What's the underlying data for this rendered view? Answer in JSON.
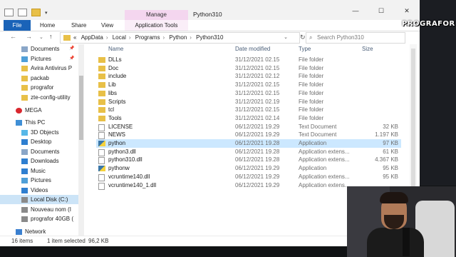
{
  "window": {
    "title": "Python310",
    "manage_tab": "Manage"
  },
  "ribbon": {
    "tabs": [
      "File",
      "Home",
      "Share",
      "View",
      "Application Tools"
    ]
  },
  "address": {
    "crumbs": [
      "AppData",
      "Local",
      "Programs",
      "Python",
      "Python310"
    ],
    "prefix": "«"
  },
  "search": {
    "placeholder": "Search Python310"
  },
  "columns": {
    "name": "Name",
    "date": "Date modified",
    "type": "Type",
    "size": "Size"
  },
  "navpane": [
    {
      "label": "Documents",
      "icon": "documents-icon",
      "pinned": true
    },
    {
      "label": "Pictures",
      "icon": "pictures-icon",
      "pinned": true
    },
    {
      "label": "Avira Antivirus P",
      "icon": "folder-icon",
      "pinned": false
    },
    {
      "label": "packab",
      "icon": "folder-icon",
      "pinned": false
    },
    {
      "label": "prografor",
      "icon": "folder-icon",
      "pinned": false
    },
    {
      "label": "zte-config-utility",
      "icon": "folder-icon",
      "pinned": false
    },
    {
      "label": "MEGA",
      "icon": "mega-icon",
      "pinned": false
    },
    {
      "label": "This PC",
      "icon": "pc-icon",
      "pinned": false
    },
    {
      "label": "3D Objects",
      "icon": "3d-objects-icon",
      "pinned": false
    },
    {
      "label": "Desktop",
      "icon": "desktop-icon",
      "pinned": false
    },
    {
      "label": "Documents",
      "icon": "documents-icon",
      "pinned": false
    },
    {
      "label": "Downloads",
      "icon": "downloads-icon",
      "pinned": false
    },
    {
      "label": "Music",
      "icon": "music-icon",
      "pinned": false
    },
    {
      "label": "Pictures",
      "icon": "pictures-icon",
      "pinned": false
    },
    {
      "label": "Videos",
      "icon": "videos-icon",
      "pinned": false
    },
    {
      "label": "Local Disk (C:)",
      "icon": "drive-icon",
      "pinned": false
    },
    {
      "label": "Nouveau nom (I",
      "icon": "drive-icon",
      "pinned": false
    },
    {
      "label": "prografor 40GB (",
      "icon": "drive-icon",
      "pinned": false
    },
    {
      "label": "Network",
      "icon": "network-icon",
      "pinned": false
    }
  ],
  "files": [
    {
      "name": "DLLs",
      "date": "31/12/2021 02.15",
      "type": "File folder",
      "size": "",
      "icon": "folder-icon"
    },
    {
      "name": "Doc",
      "date": "31/12/2021 02.15",
      "type": "File folder",
      "size": "",
      "icon": "folder-icon"
    },
    {
      "name": "include",
      "date": "31/12/2021 02.12",
      "type": "File folder",
      "size": "",
      "icon": "folder-icon"
    },
    {
      "name": "Lib",
      "date": "31/12/2021 02.15",
      "type": "File folder",
      "size": "",
      "icon": "folder-icon"
    },
    {
      "name": "libs",
      "date": "31/12/2021 02.15",
      "type": "File folder",
      "size": "",
      "icon": "folder-icon"
    },
    {
      "name": "Scripts",
      "date": "31/12/2021 02.19",
      "type": "File folder",
      "size": "",
      "icon": "folder-icon"
    },
    {
      "name": "tcl",
      "date": "31/12/2021 02.15",
      "type": "File folder",
      "size": "",
      "icon": "folder-icon"
    },
    {
      "name": "Tools",
      "date": "31/12/2021 02.14",
      "type": "File folder",
      "size": "",
      "icon": "folder-icon"
    },
    {
      "name": "LICENSE",
      "date": "06/12/2021 19.29",
      "type": "Text Document",
      "size": "32 KB",
      "icon": "text-file-icon"
    },
    {
      "name": "NEWS",
      "date": "06/12/2021 19.29",
      "type": "Text Document",
      "size": "1.197 KB",
      "icon": "text-file-icon"
    },
    {
      "name": "python",
      "date": "06/12/2021 19.28",
      "type": "Application",
      "size": "97 KB",
      "icon": "python-icon",
      "selected": true
    },
    {
      "name": "python3.dll",
      "date": "06/12/2021 19.28",
      "type": "Application extens...",
      "size": "61 KB",
      "icon": "dll-icon"
    },
    {
      "name": "python310.dll",
      "date": "06/12/2021 19.28",
      "type": "Application extens...",
      "size": "4.367 KB",
      "icon": "dll-icon"
    },
    {
      "name": "pythonw",
      "date": "06/12/2021 19.29",
      "type": "Application",
      "size": "95 KB",
      "icon": "python-icon"
    },
    {
      "name": "vcruntime140.dll",
      "date": "06/12/2021 19.29",
      "type": "Application extens...",
      "size": "95 KB",
      "icon": "dll-icon"
    },
    {
      "name": "vcruntime140_1.dll",
      "date": "06/12/2021 19.29",
      "type": "Application extens...",
      "size": "",
      "icon": "dll-icon"
    }
  ],
  "status": {
    "items": "16 items",
    "selected": "1 item selected",
    "size": "96,2 KB"
  },
  "overlay": {
    "logo_text": "PROGRAFOR"
  },
  "colors": {
    "accent": "#1a63b8",
    "manage": "#f4d6ef",
    "selection": "#cce8ff",
    "folder": "#e8c048"
  }
}
